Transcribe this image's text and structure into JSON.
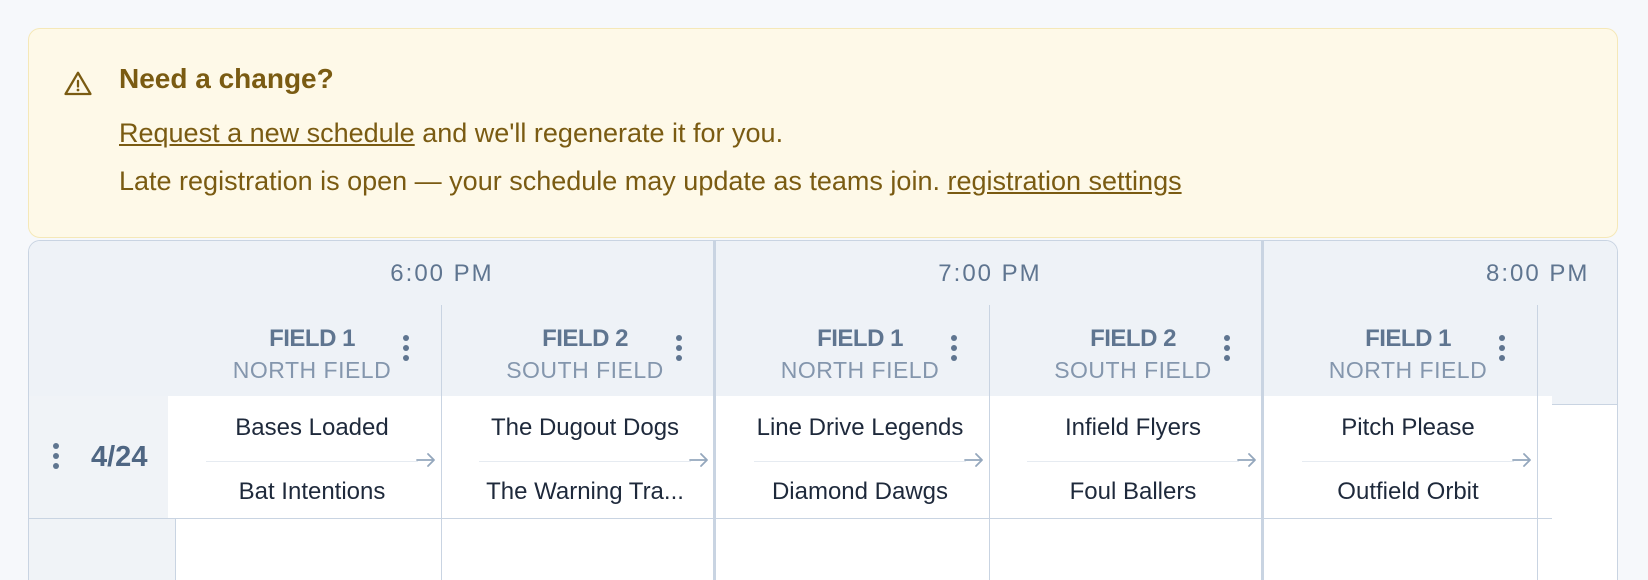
{
  "notice": {
    "title": "Need a change?",
    "request_link": "Request a new schedule",
    "request_suffix": " and we'll regenerate it for you.",
    "late_text": "Late registration is open — your schedule may update as teams join. ",
    "settings_link": "registration settings",
    "icon": "warning-icon"
  },
  "times": [
    "6:00 PM",
    "7:00 PM",
    "8:00 PM"
  ],
  "fields": [
    {
      "name": "FIELD 1",
      "location": "NORTH FIELD"
    },
    {
      "name": "FIELD 2",
      "location": "SOUTH FIELD"
    },
    {
      "name": "FIELD 1",
      "location": "NORTH FIELD"
    },
    {
      "name": "FIELD 2",
      "location": "SOUTH FIELD"
    },
    {
      "name": "FIELD 1",
      "location": "NORTH FIELD"
    }
  ],
  "rows": [
    {
      "date": "4/24",
      "games": [
        {
          "home": "Bases Loaded",
          "away": "Bat Intentions"
        },
        {
          "home": "The Dugout Dogs",
          "away": "The Warning Tra..."
        },
        {
          "home": "Line Drive Legends",
          "away": "Diamond Dawgs"
        },
        {
          "home": "Infield Flyers",
          "away": "Foul Ballers"
        },
        {
          "home": "Pitch Please",
          "away": "Outfield Orbit"
        }
      ]
    }
  ],
  "colors": {
    "notice_bg": "#fef9e8",
    "notice_text": "#7a5b12",
    "header_bg": "#eef2f7",
    "header_text": "#5f7590",
    "border": "#c9d4e2"
  }
}
